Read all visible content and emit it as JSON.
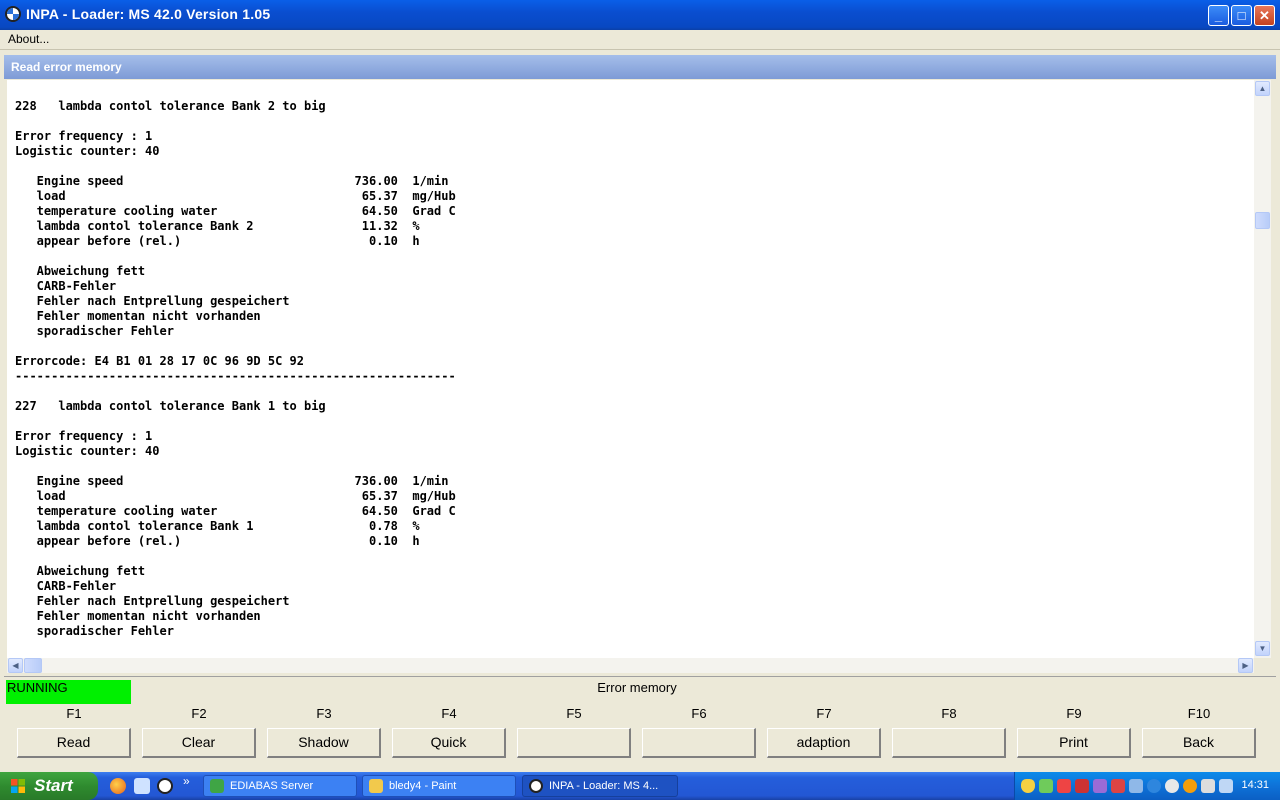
{
  "window": {
    "title": "INPA - Loader:  MS 42.0 Version 1.05",
    "minimize": "_",
    "maximize": "□",
    "close": "✕"
  },
  "menu": {
    "about": "About..."
  },
  "panel": {
    "title": "Read error memory"
  },
  "report": {
    "lines": [
      "228   lambda contol tolerance Bank 2 to big",
      "",
      "Error frequency : 1",
      "Logistic counter: 40",
      "",
      "   Engine speed                                736.00  1/min",
      "   load                                         65.37  mg/Hub",
      "   temperature cooling water                    64.50  Grad C",
      "   lambda contol tolerance Bank 2               11.32  %",
      "   appear before (rel.)                          0.10  h",
      "",
      "   Abweichung fett",
      "   CARB-Fehler",
      "   Fehler nach Entprellung gespeichert",
      "   Fehler momentan nicht vorhanden",
      "   sporadischer Fehler",
      "",
      "Errorcode: E4 B1 01 28 17 0C 96 9D 5C 92",
      "-------------------------------------------------------------",
      "",
      "227   lambda contol tolerance Bank 1 to big",
      "",
      "Error frequency : 1",
      "Logistic counter: 40",
      "",
      "   Engine speed                                736.00  1/min",
      "   load                                         65.37  mg/Hub",
      "   temperature cooling water                    64.50  Grad C",
      "   lambda contol tolerance Bank 1                0.78  %",
      "   appear before (rel.)                          0.10  h",
      "",
      "   Abweichung fett",
      "   CARB-Fehler",
      "   Fehler nach Entprellung gespeichert",
      "   Fehler momentan nicht vorhanden",
      "   sporadischer Fehler"
    ]
  },
  "status": {
    "state": "RUNNING",
    "state_color": "#00F000",
    "screen_title": "Error memory"
  },
  "fkeys": [
    {
      "key": "F1",
      "label": "Read"
    },
    {
      "key": "F2",
      "label": "Clear"
    },
    {
      "key": "F3",
      "label": "Shadow"
    },
    {
      "key": "F4",
      "label": "Quick"
    },
    {
      "key": "F5",
      "label": ""
    },
    {
      "key": "F6",
      "label": ""
    },
    {
      "key": "F7",
      "label": "adaption"
    },
    {
      "key": "F8",
      "label": ""
    },
    {
      "key": "F9",
      "label": "Print"
    },
    {
      "key": "F10",
      "label": "Back"
    }
  ],
  "taskbar": {
    "start": "Start",
    "overflow": "»",
    "tasks": [
      {
        "label": "EDIABAS Server",
        "icon": "ediabas-icon",
        "active": false
      },
      {
        "label": "bledy4 - Paint",
        "icon": "paint-icon",
        "active": false
      },
      {
        "label": "INPA - Loader:  MS 4...",
        "icon": "inpa-icon",
        "active": true
      }
    ],
    "clock": "14:31"
  }
}
